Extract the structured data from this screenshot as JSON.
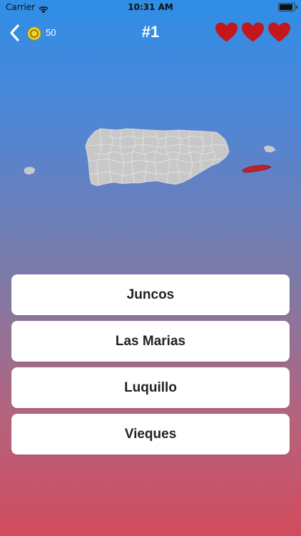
{
  "status_bar": {
    "carrier": "Carrier",
    "time": "10:31 AM"
  },
  "header": {
    "coins": "50",
    "question_number": "#1",
    "lives_remaining": 3,
    "lives_total": 3,
    "heart_color": "#c4171d"
  },
  "map": {
    "region_fill": "#c8c8c8",
    "highlight_color": "#c4202a",
    "highlighted_region_icon": "vieques-highlight"
  },
  "answers": [
    {
      "label": "Juncos"
    },
    {
      "label": "Las Marias"
    },
    {
      "label": "Luquillo"
    },
    {
      "label": "Vieques"
    }
  ]
}
